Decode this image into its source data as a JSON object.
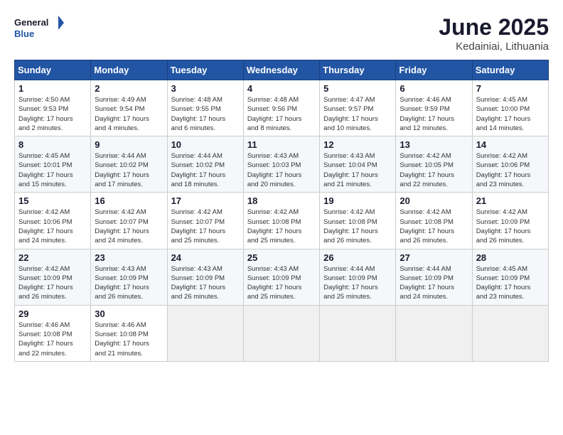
{
  "header": {
    "logo_general": "General",
    "logo_blue": "Blue",
    "month": "June 2025",
    "location": "Kedainiai, Lithuania"
  },
  "weekdays": [
    "Sunday",
    "Monday",
    "Tuesday",
    "Wednesday",
    "Thursday",
    "Friday",
    "Saturday"
  ],
  "weeks": [
    [
      {
        "day": "1",
        "info": "Sunrise: 4:50 AM\nSunset: 9:53 PM\nDaylight: 17 hours\nand 2 minutes."
      },
      {
        "day": "2",
        "info": "Sunrise: 4:49 AM\nSunset: 9:54 PM\nDaylight: 17 hours\nand 4 minutes."
      },
      {
        "day": "3",
        "info": "Sunrise: 4:48 AM\nSunset: 9:55 PM\nDaylight: 17 hours\nand 6 minutes."
      },
      {
        "day": "4",
        "info": "Sunrise: 4:48 AM\nSunset: 9:56 PM\nDaylight: 17 hours\nand 8 minutes."
      },
      {
        "day": "5",
        "info": "Sunrise: 4:47 AM\nSunset: 9:57 PM\nDaylight: 17 hours\nand 10 minutes."
      },
      {
        "day": "6",
        "info": "Sunrise: 4:46 AM\nSunset: 9:59 PM\nDaylight: 17 hours\nand 12 minutes."
      },
      {
        "day": "7",
        "info": "Sunrise: 4:45 AM\nSunset: 10:00 PM\nDaylight: 17 hours\nand 14 minutes."
      }
    ],
    [
      {
        "day": "8",
        "info": "Sunrise: 4:45 AM\nSunset: 10:01 PM\nDaylight: 17 hours\nand 15 minutes."
      },
      {
        "day": "9",
        "info": "Sunrise: 4:44 AM\nSunset: 10:02 PM\nDaylight: 17 hours\nand 17 minutes."
      },
      {
        "day": "10",
        "info": "Sunrise: 4:44 AM\nSunset: 10:02 PM\nDaylight: 17 hours\nand 18 minutes."
      },
      {
        "day": "11",
        "info": "Sunrise: 4:43 AM\nSunset: 10:03 PM\nDaylight: 17 hours\nand 20 minutes."
      },
      {
        "day": "12",
        "info": "Sunrise: 4:43 AM\nSunset: 10:04 PM\nDaylight: 17 hours\nand 21 minutes."
      },
      {
        "day": "13",
        "info": "Sunrise: 4:42 AM\nSunset: 10:05 PM\nDaylight: 17 hours\nand 22 minutes."
      },
      {
        "day": "14",
        "info": "Sunrise: 4:42 AM\nSunset: 10:06 PM\nDaylight: 17 hours\nand 23 minutes."
      }
    ],
    [
      {
        "day": "15",
        "info": "Sunrise: 4:42 AM\nSunset: 10:06 PM\nDaylight: 17 hours\nand 24 minutes."
      },
      {
        "day": "16",
        "info": "Sunrise: 4:42 AM\nSunset: 10:07 PM\nDaylight: 17 hours\nand 24 minutes."
      },
      {
        "day": "17",
        "info": "Sunrise: 4:42 AM\nSunset: 10:07 PM\nDaylight: 17 hours\nand 25 minutes."
      },
      {
        "day": "18",
        "info": "Sunrise: 4:42 AM\nSunset: 10:08 PM\nDaylight: 17 hours\nand 25 minutes."
      },
      {
        "day": "19",
        "info": "Sunrise: 4:42 AM\nSunset: 10:08 PM\nDaylight: 17 hours\nand 26 minutes."
      },
      {
        "day": "20",
        "info": "Sunrise: 4:42 AM\nSunset: 10:08 PM\nDaylight: 17 hours\nand 26 minutes."
      },
      {
        "day": "21",
        "info": "Sunrise: 4:42 AM\nSunset: 10:09 PM\nDaylight: 17 hours\nand 26 minutes."
      }
    ],
    [
      {
        "day": "22",
        "info": "Sunrise: 4:42 AM\nSunset: 10:09 PM\nDaylight: 17 hours\nand 26 minutes."
      },
      {
        "day": "23",
        "info": "Sunrise: 4:43 AM\nSunset: 10:09 PM\nDaylight: 17 hours\nand 26 minutes."
      },
      {
        "day": "24",
        "info": "Sunrise: 4:43 AM\nSunset: 10:09 PM\nDaylight: 17 hours\nand 26 minutes."
      },
      {
        "day": "25",
        "info": "Sunrise: 4:43 AM\nSunset: 10:09 PM\nDaylight: 17 hours\nand 25 minutes."
      },
      {
        "day": "26",
        "info": "Sunrise: 4:44 AM\nSunset: 10:09 PM\nDaylight: 17 hours\nand 25 minutes."
      },
      {
        "day": "27",
        "info": "Sunrise: 4:44 AM\nSunset: 10:09 PM\nDaylight: 17 hours\nand 24 minutes."
      },
      {
        "day": "28",
        "info": "Sunrise: 4:45 AM\nSunset: 10:09 PM\nDaylight: 17 hours\nand 23 minutes."
      }
    ],
    [
      {
        "day": "29",
        "info": "Sunrise: 4:46 AM\nSunset: 10:08 PM\nDaylight: 17 hours\nand 22 minutes."
      },
      {
        "day": "30",
        "info": "Sunrise: 4:46 AM\nSunset: 10:08 PM\nDaylight: 17 hours\nand 21 minutes."
      },
      {
        "day": "",
        "info": ""
      },
      {
        "day": "",
        "info": ""
      },
      {
        "day": "",
        "info": ""
      },
      {
        "day": "",
        "info": ""
      },
      {
        "day": "",
        "info": ""
      }
    ]
  ]
}
